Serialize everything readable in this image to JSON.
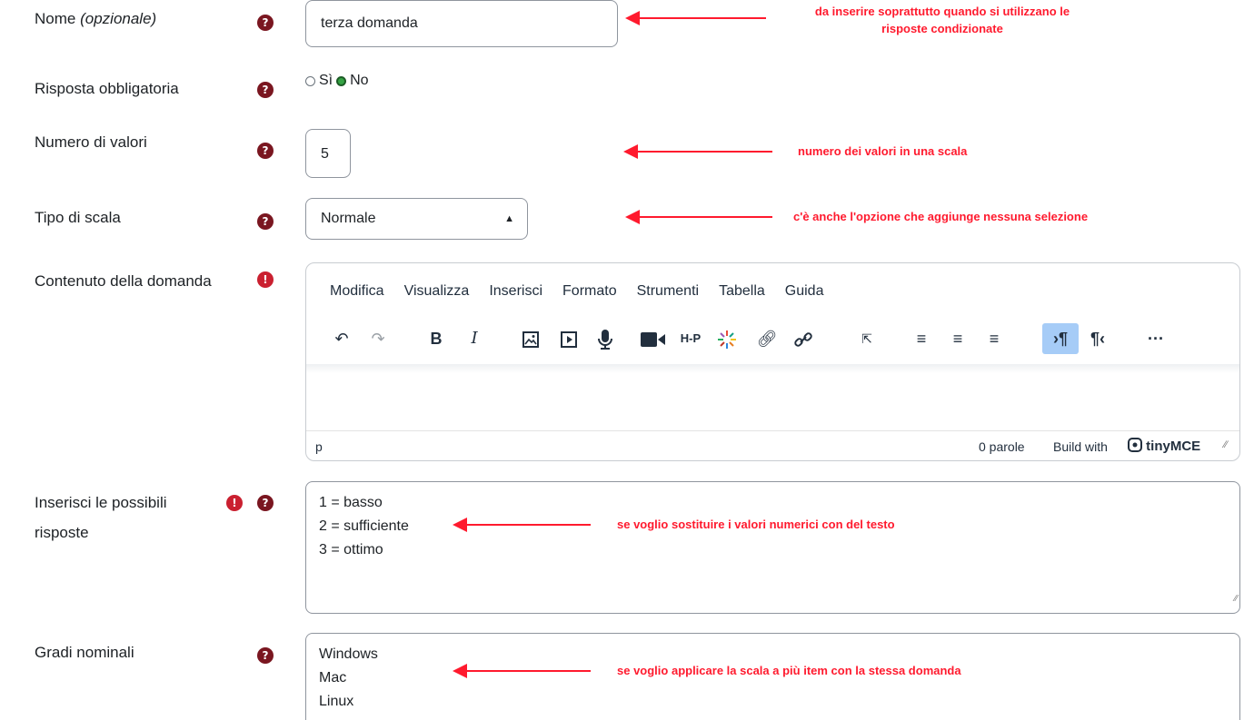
{
  "fields": {
    "name": {
      "label": "Nome",
      "label_hint": "(opzionale)",
      "value": "terza domanda"
    },
    "required": {
      "label": "Risposta obbligatoria",
      "options": [
        "Sì",
        "No"
      ],
      "selected": "No"
    },
    "num_values": {
      "label": "Numero di valori",
      "value": "5"
    },
    "scale_type": {
      "label": "Tipo di scala",
      "value": "Normale"
    },
    "content": {
      "label": "Contenuto della domanda"
    },
    "answers": {
      "label_line1": "Inserisci le possibili",
      "label_line2": "risposte",
      "lines": [
        "1 = basso",
        "2 = sufficiente",
        "3 = ottimo"
      ]
    },
    "nominal": {
      "label": "Gradi nominali",
      "lines": [
        "Windows",
        "Mac",
        "Linux"
      ]
    }
  },
  "editor": {
    "menu": [
      "Modifica",
      "Visualizza",
      "Inserisci",
      "Formato",
      "Strumenti",
      "Tabella",
      "Guida"
    ],
    "status_path": "p",
    "word_count": "0 parole",
    "build_with": "Build with",
    "brand": "tinyMCE"
  },
  "annotations": {
    "name_line1": "da inserire soprattutto quando si utilizzano le",
    "name_line2": "risposte condizionate",
    "num_values": "numero dei valori in una scala",
    "scale_type": "c'è anche l'opzione che aggiunge nessuna selezione",
    "answers": "se voglio sostituire i valori numerici con del testo",
    "nominal": "se voglio applicare la scala a più item con la stessa domanda"
  },
  "icons": {
    "help": "question-circle-icon",
    "required": "exclamation-circle-icon",
    "help_glyph": "?",
    "required_glyph": "!"
  },
  "colors": {
    "annotation": "#ff1a2e",
    "help_icon": "#7a1620",
    "required_icon": "#ca2030",
    "radio_selected": "#35a344",
    "toolbar_active": "#a6ccf7"
  }
}
